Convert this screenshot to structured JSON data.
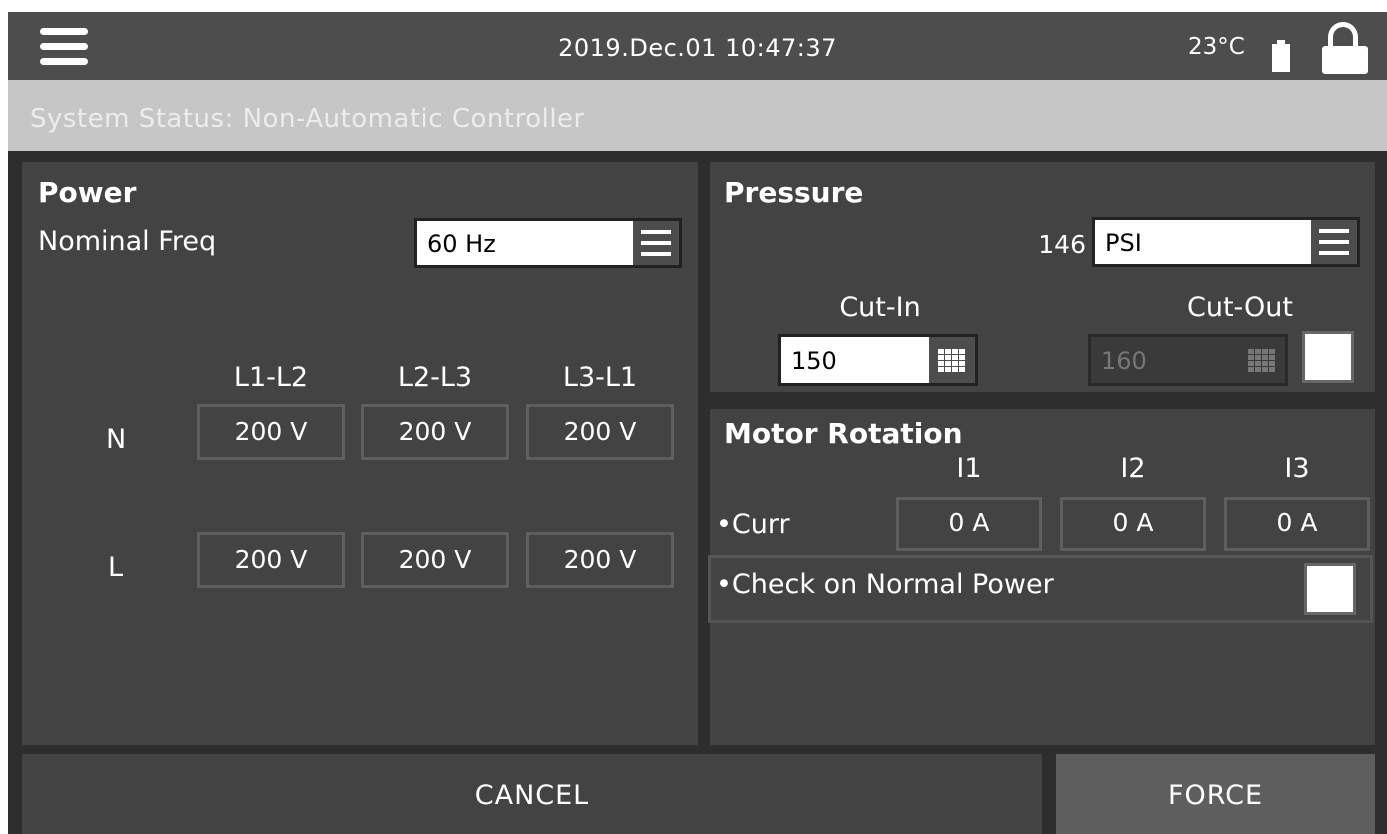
{
  "header": {
    "datetime": "2019.Dec.01 10:47:37",
    "temperature": "23°C"
  },
  "status": {
    "text": "System Status: Non-Automatic Controller"
  },
  "power": {
    "title": "Power",
    "nominal_freq_label": "Nominal Freq",
    "nominal_freq_value": "60 Hz",
    "columns": [
      "L1-L2",
      "L2-L3",
      "L3-L1"
    ],
    "rows": [
      {
        "label": "N",
        "values": [
          "200 V",
          "200 V",
          "200 V"
        ]
      },
      {
        "label": "L",
        "values": [
          "200 V",
          "200 V",
          "200 V"
        ]
      }
    ]
  },
  "pressure": {
    "title": "Pressure",
    "reading": "146",
    "unit": "PSI",
    "cut_in_label": "Cut-In",
    "cut_in_value": "150",
    "cut_out_label": "Cut-Out",
    "cut_out_value": "160"
  },
  "motor_rotation": {
    "title": "Motor Rotation",
    "columns": [
      "I1",
      "I2",
      "I3"
    ],
    "curr_label": "•Curr",
    "curr_values": [
      "0 A",
      "0 A",
      "0 A"
    ],
    "check_label": "•Check on Normal Power"
  },
  "buttons": {
    "cancel": "CANCEL",
    "force": "FORCE"
  }
}
